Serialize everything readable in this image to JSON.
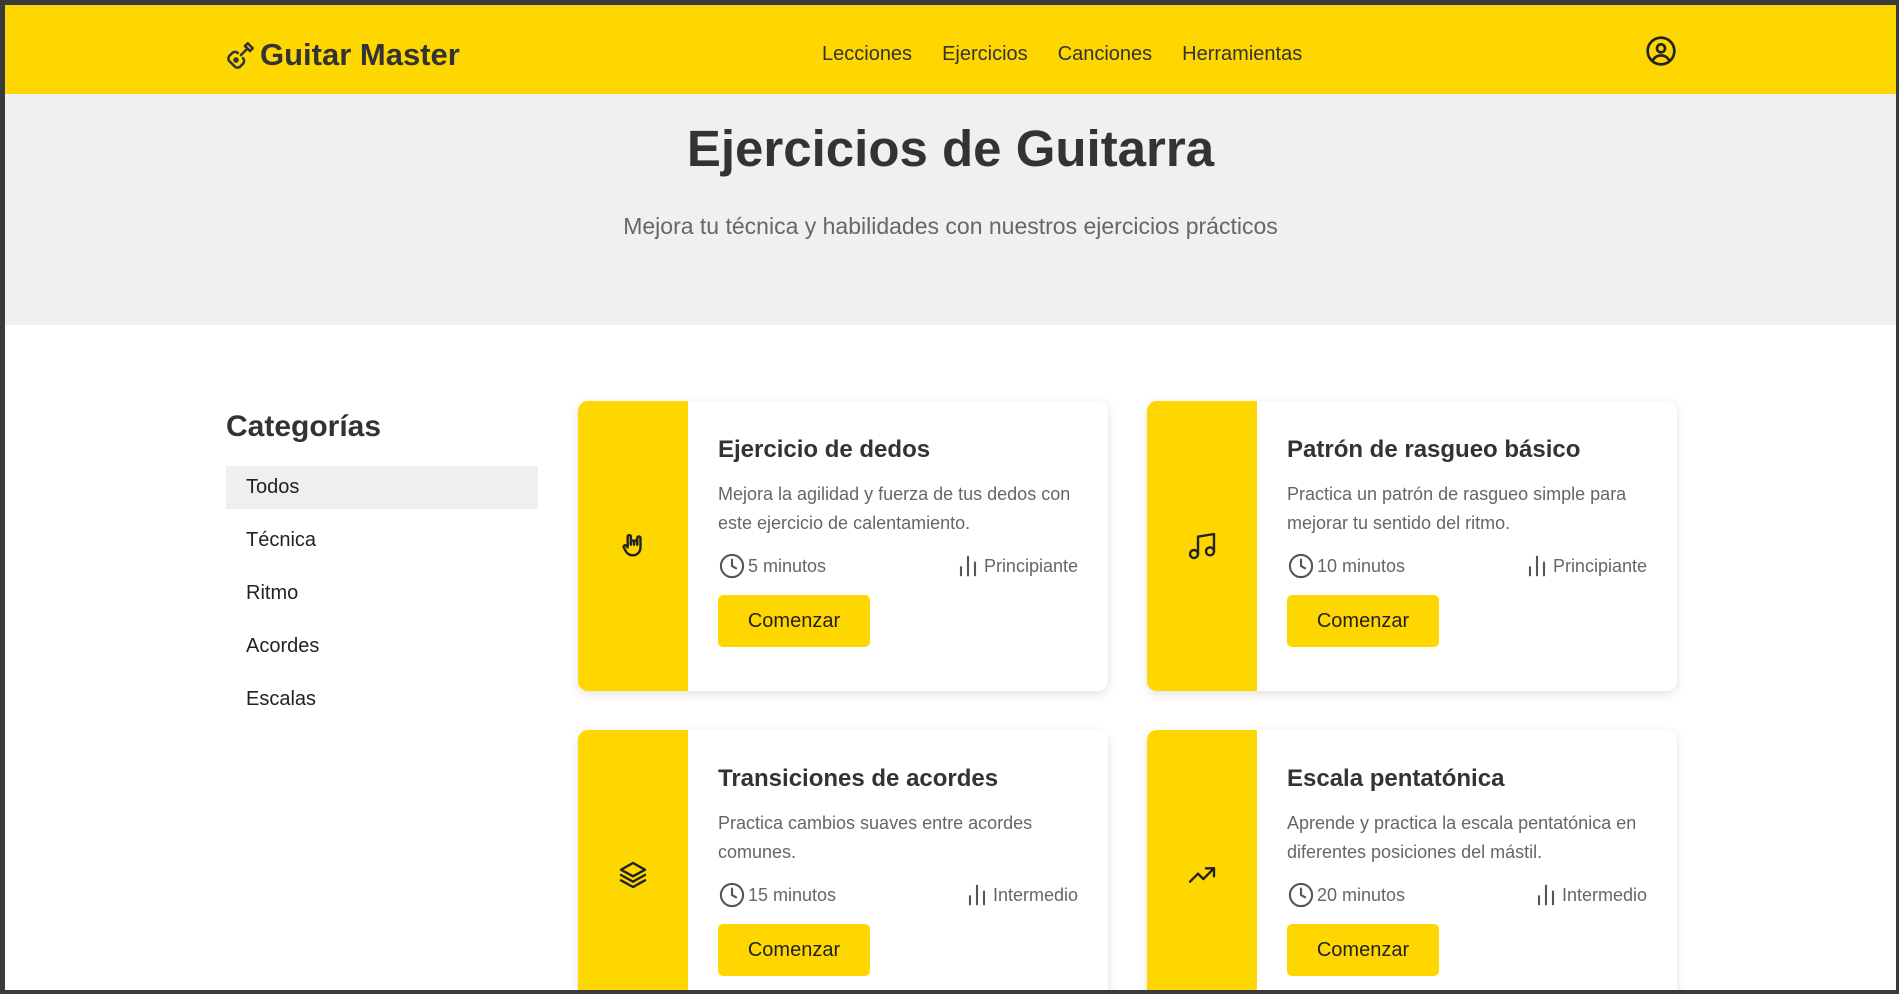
{
  "brand": {
    "name": "Guitar Master",
    "icon": "guitar-icon"
  },
  "nav": {
    "items": [
      {
        "label": "Lecciones"
      },
      {
        "label": "Ejercicios"
      },
      {
        "label": "Canciones"
      },
      {
        "label": "Herramientas"
      }
    ],
    "user_icon": "user-circle-icon"
  },
  "hero": {
    "title": "Ejercicios de Guitarra",
    "subtitle": "Mejora tu técnica y habilidades con nuestros ejercicios prácticos"
  },
  "sidebar": {
    "title": "Categorías",
    "items": [
      {
        "label": "Todos",
        "active": true
      },
      {
        "label": "Técnica"
      },
      {
        "label": "Ritmo"
      },
      {
        "label": "Acordes"
      },
      {
        "label": "Escalas"
      }
    ]
  },
  "cards": [
    {
      "icon": "hand-rock-icon",
      "title": "Ejercicio de dedos",
      "description": "Mejora la agilidad y fuerza de tus dedos con este ejercicio de calentamiento.",
      "duration": "5 minutos",
      "level": "Principiante",
      "button": "Comenzar"
    },
    {
      "icon": "music-note-icon",
      "title": "Patrón de rasgueo básico",
      "description": "Practica un patrón de rasgueo simple para mejorar tu sentido del ritmo.",
      "duration": "10 minutos",
      "level": "Principiante",
      "button": "Comenzar"
    },
    {
      "icon": "layers-icon",
      "title": "Transiciones de acordes",
      "description": "Practica cambios suaves entre acordes comunes.",
      "duration": "15 minutos",
      "level": "Intermedio",
      "button": "Comenzar"
    },
    {
      "icon": "trending-up-icon",
      "title": "Escala pentatónica",
      "description": "Aprende y practica la escala pentatónica en diferentes posiciones del mástil.",
      "duration": "20 minutos",
      "level": "Intermedio",
      "button": "Comenzar"
    }
  ],
  "colors": {
    "accent": "#FFD700",
    "hero_bg": "#f0f0f0",
    "text": "#333333"
  }
}
